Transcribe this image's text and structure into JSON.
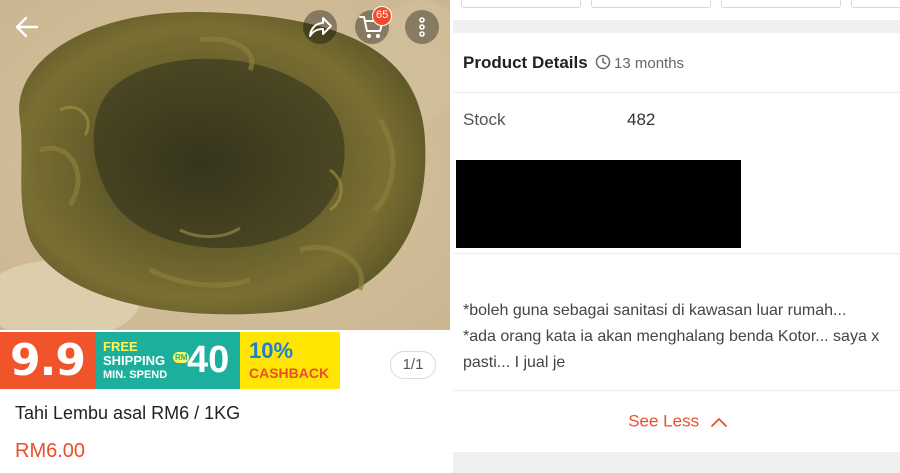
{
  "product": {
    "title": "Tahi Lembu asal RM6 / 1KG",
    "price": "RM6.00",
    "image_counter": "1/1"
  },
  "header": {
    "icons": [
      "back-arrow-icon",
      "share-icon",
      "cart-icon",
      "more-vertical-icon"
    ],
    "cart_count": "65"
  },
  "promo_banner": {
    "sale_label": "9.9",
    "free_shipping_line1": "FREE",
    "free_shipping_line2": "SHIPPING",
    "min_spend_label": "MIN. SPEND",
    "currency_badge": "RM",
    "min_spend_amount": "40",
    "cashback_percent": "10%",
    "cashback_label": "CASHBACK"
  },
  "details": {
    "section_title": "Product Details",
    "listed_ago": "13 months",
    "stock_label": "Stock",
    "stock_value": "482",
    "description_lines": [
      "*boleh guna sebagai sanitasi di kawasan luar rumah...",
      "*ada orang kata ia akan menghalang benda Kotor... saya x pasti... I jual je"
    ],
    "see_less_label": "See Less"
  },
  "colors": {
    "accent": "#ee4d2d",
    "banner_red": "#f0542a",
    "banner_teal": "#1cb09c",
    "banner_yellow": "#ffe600",
    "separator": "#f0f0f0"
  }
}
